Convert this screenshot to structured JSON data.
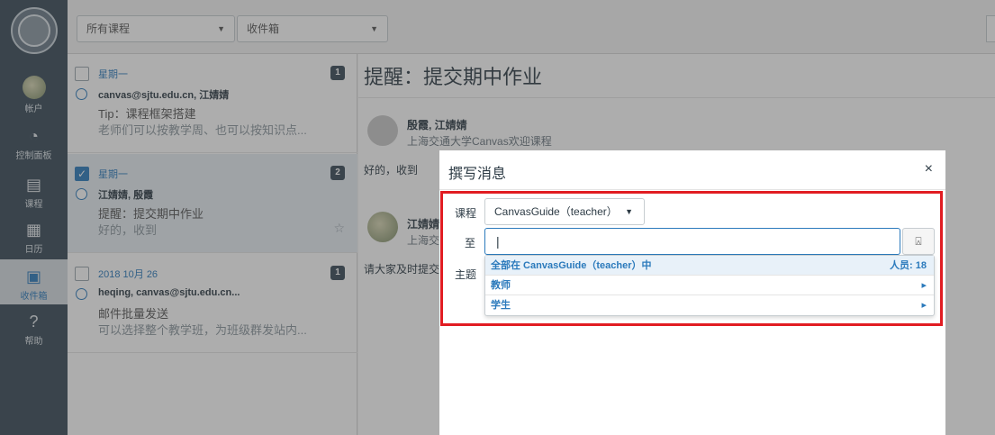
{
  "nav": {
    "account": "帐户",
    "dashboard": "控制面板",
    "courses": "课程",
    "calendar": "日历",
    "inbox": "收件箱",
    "help": "帮助"
  },
  "toolbar": {
    "course_filter": "所有课程",
    "mailbox_filter": "收件箱"
  },
  "messages": [
    {
      "date": "星期一",
      "count": "1",
      "from": "canvas@sjtu.edu.cn, 江婧婧",
      "subject": "Tip：课程框架搭建",
      "preview": "老师们可以按教学周、也可以按知识点..."
    },
    {
      "date": "星期一",
      "count": "2",
      "from": "江婧婧, 殷霞",
      "subject": "提醒：提交期中作业",
      "preview": "好的，收到"
    },
    {
      "date": "2018 10月 26",
      "count": "1",
      "from": "heqing, canvas@sjtu.edu.cn...",
      "subject": "邮件批量发送",
      "preview": "可以选择整个教学班，为班级群发站内..."
    }
  ],
  "reading": {
    "title": "提醒：提交期中作业",
    "msg1_name": "殷霞, 江婧婧",
    "msg1_course": "上海交通大学Canvas欢迎课程",
    "msg1_body": "好的，收到",
    "msg2_name": "江婧婧",
    "msg2_course": "上海交",
    "msg2_body": "请大家及时提交"
  },
  "compose": {
    "title": "撰写消息",
    "close": "×",
    "course_label": "课程",
    "course_value": "CanvasGuide（teacher）",
    "to_label": "至",
    "to_value": "|",
    "subject_label": "主题",
    "options": [
      {
        "label": "全部在 CanvasGuide（teacher）中",
        "right": "人员: 18"
      },
      {
        "label": "教师",
        "right": "▸"
      },
      {
        "label": "学生",
        "right": "▸"
      }
    ]
  },
  "colors": {
    "nav_bg": "#394b58",
    "accent": "#2b7abc",
    "highlight": "#e11c22"
  }
}
